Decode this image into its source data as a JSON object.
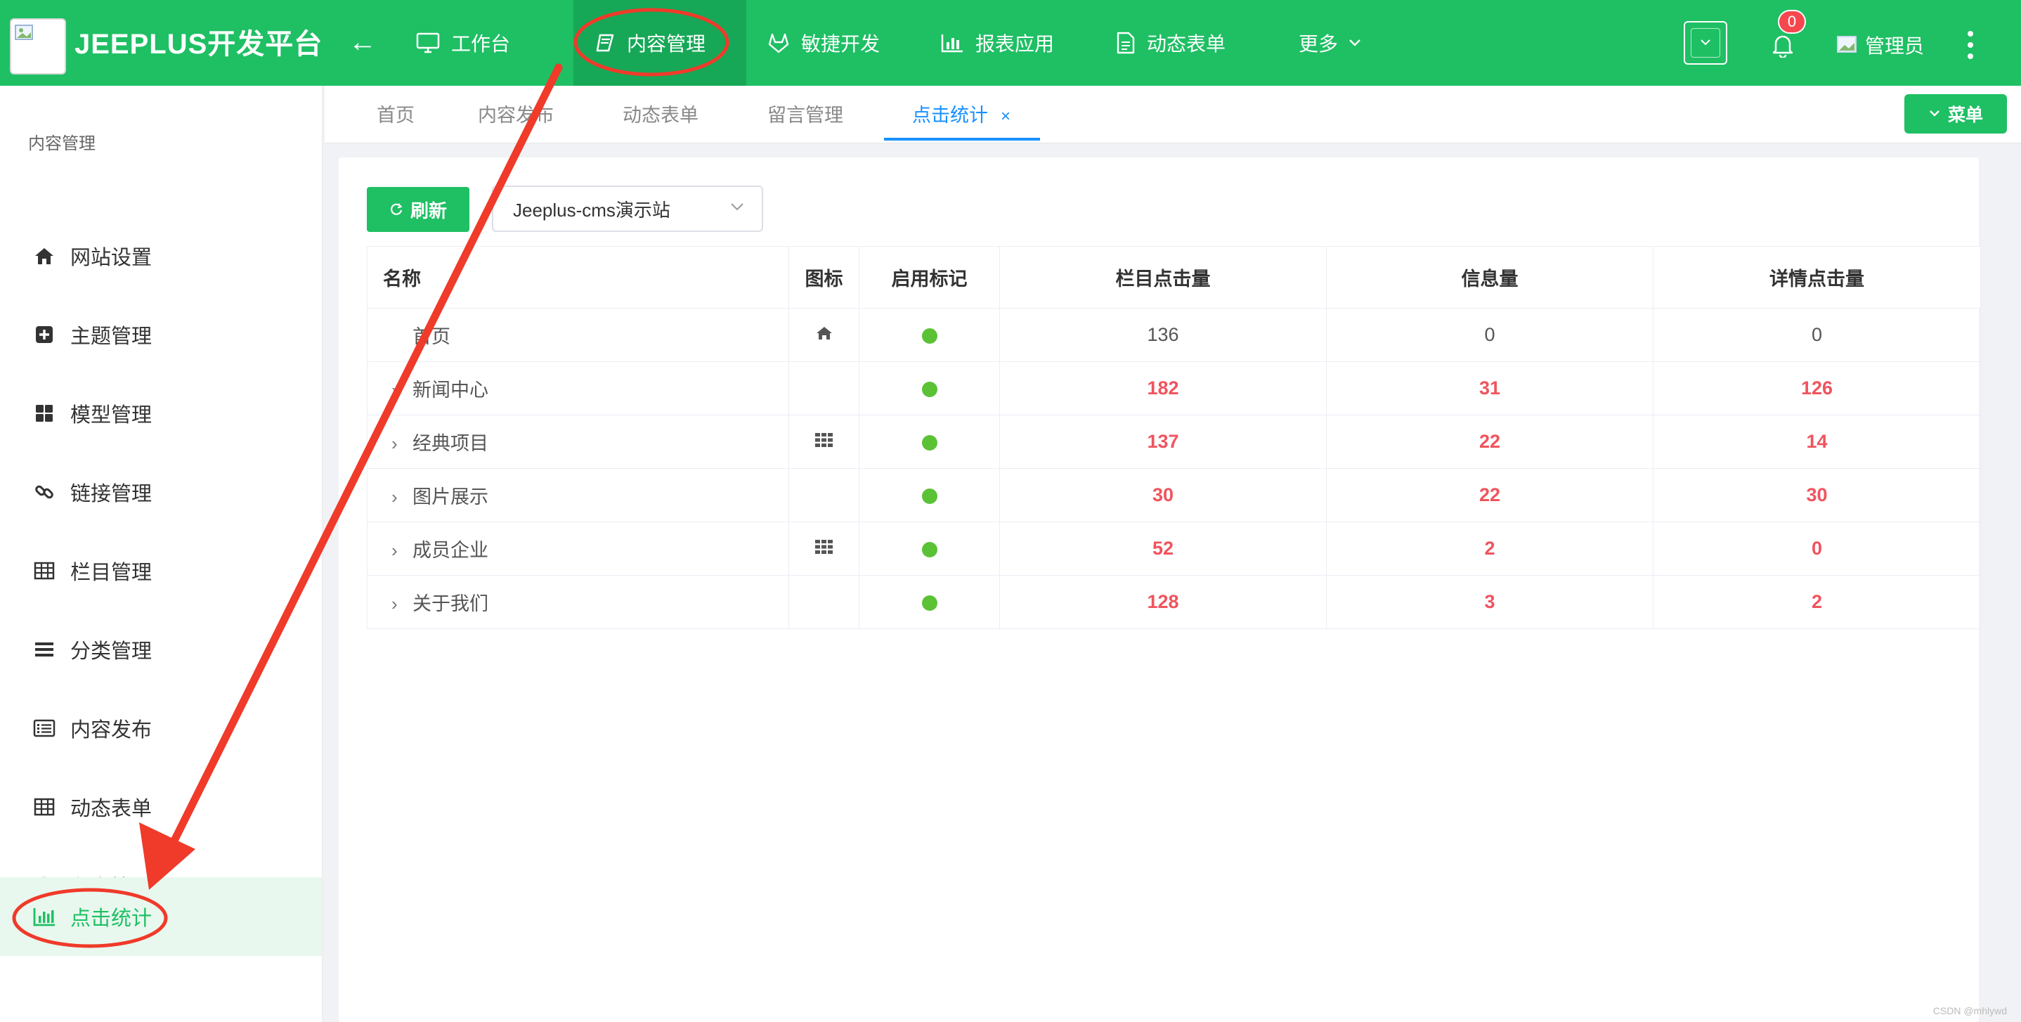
{
  "header": {
    "brand": "JEEPLUS开发平台",
    "back_icon": "arrow-left-icon",
    "nav": [
      {
        "label": "工作台",
        "icon": "monitor-icon"
      },
      {
        "label": "内容管理",
        "icon": "book-icon"
      },
      {
        "label": "敏捷开发",
        "icon": "gitlab-icon"
      },
      {
        "label": "报表应用",
        "icon": "bar-chart-icon"
      },
      {
        "label": "动态表单",
        "icon": "document-icon"
      },
      {
        "label": "更多",
        "icon": "chevron-down-icon"
      }
    ],
    "notification_count": "0",
    "user_name": "管理员",
    "accent": "#1fbf64",
    "active_nav_bg": "#17a857"
  },
  "sidebar": {
    "title": "内容管理",
    "items": [
      {
        "label": "网站设置",
        "icon": "home-icon"
      },
      {
        "label": "主题管理",
        "icon": "plus-square-icon"
      },
      {
        "label": "模型管理",
        "icon": "grid-icon"
      },
      {
        "label": "链接管理",
        "icon": "link-icon"
      },
      {
        "label": "栏目管理",
        "icon": "table-icon"
      },
      {
        "label": "分类管理",
        "icon": "list-icon"
      },
      {
        "label": "内容发布",
        "icon": "list-alt-icon"
      },
      {
        "label": "动态表单",
        "icon": "table-icon"
      },
      {
        "label": "留言管理",
        "icon": "comment-icon"
      },
      {
        "label": "点击统计",
        "icon": "bar-chart-icon"
      }
    ],
    "active_index": 9
  },
  "tabs": [
    {
      "label": "首页"
    },
    {
      "label": "内容发布"
    },
    {
      "label": "动态表单"
    },
    {
      "label": "留言管理"
    },
    {
      "label": "点击统计",
      "closable": true
    }
  ],
  "menu_button": "菜单",
  "toolbar": {
    "refresh_label": "刷新",
    "site_selected": "Jeeplus-cms演示站"
  },
  "table": {
    "columns": [
      "名称",
      "图标",
      "启用标记",
      "栏目点击量",
      "信息量",
      "详情点击量"
    ],
    "rows": [
      {
        "name": "首页",
        "expandable": false,
        "icon": "home-icon",
        "enabled": true,
        "column_clicks": "136",
        "info_count": "0",
        "detail_clicks": "0",
        "hot": false
      },
      {
        "name": "新闻中心",
        "expandable": true,
        "icon": "",
        "enabled": true,
        "column_clicks": "182",
        "info_count": "31",
        "detail_clicks": "126",
        "hot": true
      },
      {
        "name": "经典项目",
        "expandable": true,
        "icon": "th-icon",
        "enabled": true,
        "column_clicks": "137",
        "info_count": "22",
        "detail_clicks": "14",
        "hot": true
      },
      {
        "name": "图片展示",
        "expandable": true,
        "icon": "",
        "enabled": true,
        "column_clicks": "30",
        "info_count": "22",
        "detail_clicks": "30",
        "hot": true
      },
      {
        "name": "成员企业",
        "expandable": true,
        "icon": "th-icon",
        "enabled": true,
        "column_clicks": "52",
        "info_count": "2",
        "detail_clicks": "0",
        "hot": true
      },
      {
        "name": "关于我们",
        "expandable": true,
        "icon": "",
        "enabled": true,
        "column_clicks": "128",
        "info_count": "3",
        "detail_clicks": "2",
        "hot": true
      }
    ],
    "enabled_color": "#5bc236",
    "hot_color": "#f0545e"
  },
  "annotation": {
    "color": "#f03a2a"
  },
  "watermark": "CSDN @mhlywd"
}
